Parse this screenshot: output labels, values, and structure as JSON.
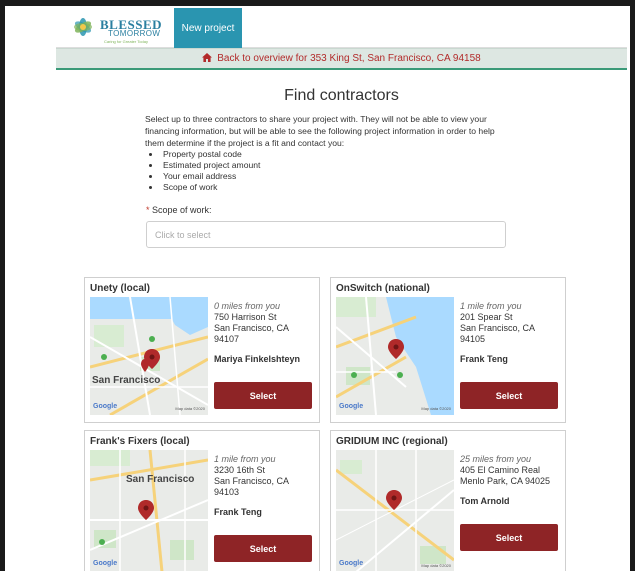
{
  "header": {
    "logo_name": "BLESSED",
    "logo_sub": "TOMORROW",
    "logo_tag": "Caring for Greater Today",
    "tab_label": "New project"
  },
  "backbar": {
    "label": "Back to overview for 353 King St, San Francisco, CA 94158"
  },
  "page_title": "Find contractors",
  "intro": {
    "text": "Select up to three contractors to share your project with. They will not be able to view your financing information, but will be able to see the following project information in order to help them determine if the project is a fit and contact you:",
    "items": [
      "Property postal code",
      "Estimated project amount",
      "Your email address",
      "Scope of work"
    ]
  },
  "scope": {
    "required_mark": "*",
    "label": "Scope of work:",
    "placeholder": "Click to select"
  },
  "contractors": [
    {
      "name": "Unety (local)",
      "distance": "0 miles from you",
      "street": "750 Harrison St",
      "city": "San Francisco, CA",
      "zip": "94107",
      "contact": "Mariya Finkelshteyn",
      "button": "Select",
      "map_labels": [
        "San Francisco",
        "Google",
        "Map data ©2020"
      ]
    },
    {
      "name": "OnSwitch (national)",
      "distance": "1 mile from you",
      "street": "201 Spear St",
      "city": "San Francisco, CA",
      "zip": "94105",
      "contact": "Frank Teng",
      "button": "Select",
      "map_labels": [
        "",
        "Google",
        "Map data ©2020"
      ]
    },
    {
      "name": "Frank's Fixers (local)",
      "distance": "1 mile from you",
      "street": "3230 16th St",
      "city": "San Francisco, CA",
      "zip": "94103",
      "contact": "Frank Teng",
      "button": "Select",
      "map_labels": [
        "San Francisco",
        "Google",
        "Map data ©2020"
      ]
    },
    {
      "name": "GRIDIUM INC (regional)",
      "distance": "25 miles from you",
      "street": "405 El Camino Real",
      "city": "Menlo Park, CA 94025",
      "zip": "",
      "contact": "Tom Arnold",
      "button": "Select",
      "map_labels": [
        "",
        "Google",
        "Map data ©2020"
      ]
    }
  ],
  "colors": {
    "brand_teal": "#2a95b0",
    "accent_red": "#8e2426",
    "back_link": "#b22a2a",
    "backbar_bg": "#dde7e2"
  }
}
